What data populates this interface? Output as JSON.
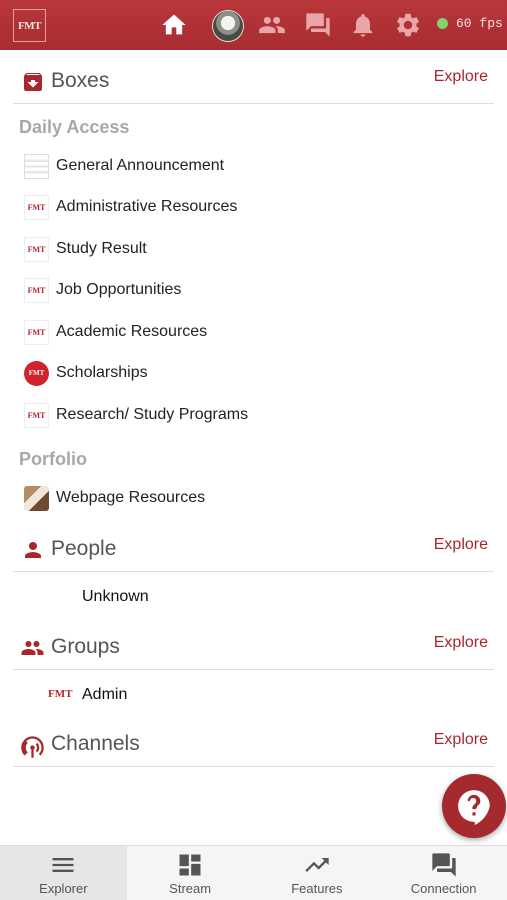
{
  "topbar": {
    "logo_text": "FMT",
    "fps_text": "60 fps",
    "icons": [
      "home-icon",
      "avatar",
      "people-icon",
      "chat-icon",
      "bell-icon",
      "gear-icon"
    ]
  },
  "boxes": {
    "title": "Boxes",
    "explore": "Explore",
    "daily_access": {
      "heading": "Daily Access",
      "items": [
        {
          "label": "General Announcement"
        },
        {
          "label": "Administrative Resources"
        },
        {
          "label": "Study Result"
        },
        {
          "label": "Job Opportunities"
        },
        {
          "label": "Academic Resources"
        },
        {
          "label": "Scholarships"
        },
        {
          "label": "Research/ Study Programs"
        }
      ]
    },
    "portfolio": {
      "heading": "Porfolio",
      "items": [
        {
          "label": "Webpage Resources"
        }
      ]
    }
  },
  "people": {
    "title": "People",
    "explore": "Explore",
    "items": [
      {
        "label": "Unknown"
      }
    ]
  },
  "groups": {
    "title": "Groups",
    "explore": "Explore",
    "items": [
      {
        "label": "Admin",
        "badge": "FMT"
      }
    ]
  },
  "channels": {
    "title": "Channels",
    "explore": "Explore"
  },
  "icon_badge_text": "FMT",
  "bottom_nav": [
    {
      "label": "Explorer",
      "icon": "menu-icon",
      "active": true
    },
    {
      "label": "Stream",
      "icon": "dashboard-icon",
      "active": false
    },
    {
      "label": "Features",
      "icon": "trending-icon",
      "active": false
    },
    {
      "label": "Connection",
      "icon": "forum-icon",
      "active": false
    }
  ],
  "colors": {
    "brand": "#a82c30",
    "accent_text": "#a8272c"
  }
}
